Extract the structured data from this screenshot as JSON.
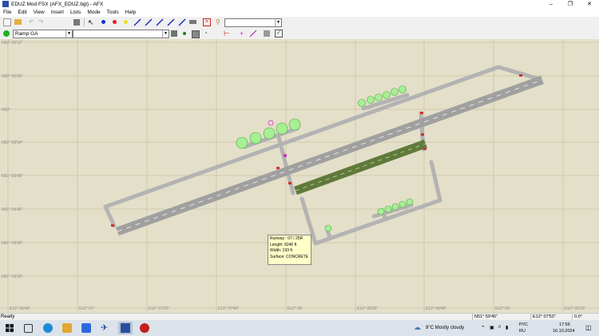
{
  "window": {
    "title": "EDUZ Mod FSX (AFX_EDUZ.bgl) - AFX"
  },
  "menu": [
    "File",
    "Edit",
    "View",
    "Insert",
    "Lists",
    "Mode",
    "Tools",
    "Help"
  ],
  "toolbar2": {
    "layer_combo": "Ramp GA",
    "second_combo": ""
  },
  "map": {
    "lat_labels": [
      "N52° 00'12\"",
      "N52° 00'06\"",
      "N52°",
      "N51° 59'54\"",
      "N51° 59'48\"",
      "N51° 59'42\"",
      "N51° 59'36\"",
      "N51° 59'30\""
    ],
    "lon_labels": [
      "E12° 06'46\"",
      "E12° 07'",
      "E12° 07'20\"",
      "E12° 07'40\"",
      "E12° 08'",
      "E12° 08'20\"",
      "E12° 08'40\"",
      "E12° 09'",
      "E12° 09'20\""
    ]
  },
  "tooltip": {
    "runway": "Runway : 07 / 25R",
    "length": "Length:   8246 ft",
    "width": "Width:    193 ft",
    "surface": "Surface:   CONCRETE"
  },
  "status": {
    "ready": "Ready",
    "lat": "N51° 59'45\"",
    "lon": "E12° 07'53\"",
    "heading": "0.0°"
  },
  "taskbar": {
    "weather": "9°C  Mostly cloudy",
    "lang_top": "РУС",
    "lang_bottom": "RU",
    "time": "17:56",
    "date": "16.10.2024"
  },
  "colors": {
    "map_bg": "#e4dfc9",
    "runway": "#a0a0a0",
    "taxiway": "#b3b3b3",
    "grid": "#cfc8ac",
    "selected_runway": "#5f7a3a"
  }
}
